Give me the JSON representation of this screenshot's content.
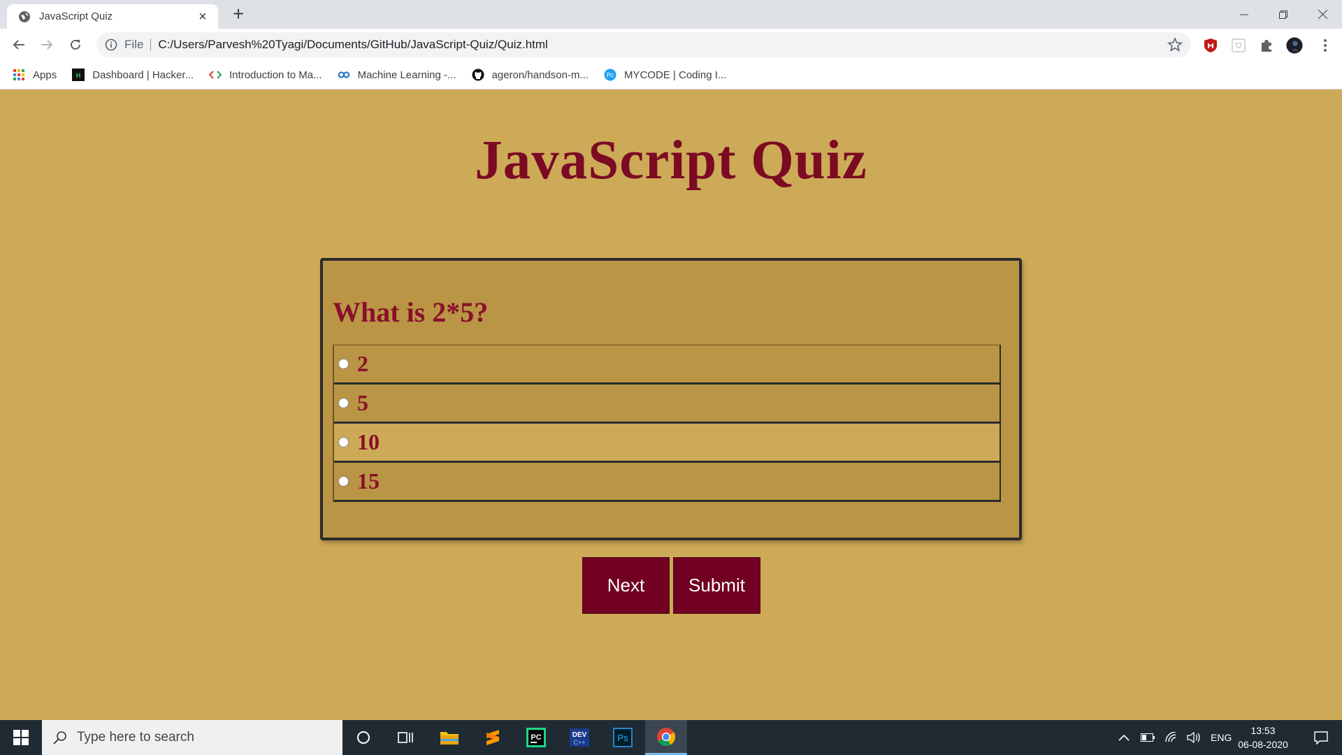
{
  "browser": {
    "tab_title": "JavaScript Quiz",
    "url_scheme": "File",
    "url": "C:/Users/Parvesh%20Tyagi/Documents/GitHub/JavaScript-Quiz/Quiz.html",
    "bookmarks": [
      {
        "label": "Apps",
        "icon": "apps-grid-icon"
      },
      {
        "label": "Dashboard | Hacker...",
        "icon": "hackerrank-icon"
      },
      {
        "label": "Introduction to Ma...",
        "icon": "code-brackets-icon"
      },
      {
        "label": "Machine Learning -...",
        "icon": "coursera-icon"
      },
      {
        "label": "ageron/handson-m...",
        "icon": "github-icon"
      },
      {
        "label": "MYCODE | Coding I...",
        "icon": "mycode-icon"
      }
    ]
  },
  "page": {
    "title": "JavaScript Quiz",
    "question": "What is 2*5?",
    "answers": [
      "2",
      "5",
      "10",
      "15"
    ],
    "next_label": "Next",
    "submit_label": "Submit"
  },
  "taskbar": {
    "search_placeholder": "Type here to search",
    "language": "ENG",
    "time": "13:53",
    "date": "06-08-2020"
  },
  "colors": {
    "page_background": "#cdaa57",
    "quiz_box": "#b99545",
    "title": "#7b0a23",
    "button": "#710023"
  }
}
